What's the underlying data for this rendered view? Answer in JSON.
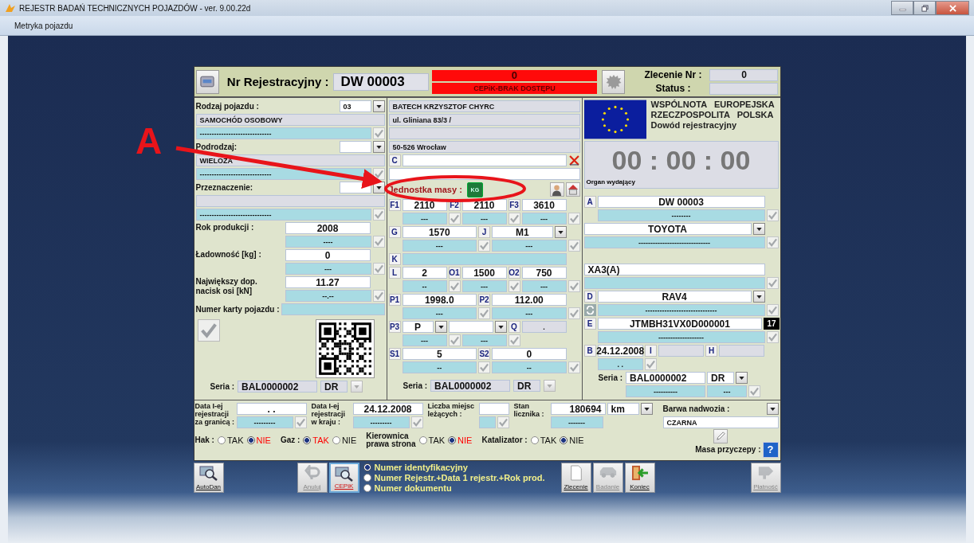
{
  "window": {
    "title": "REJESTR BADAŃ TECHNICZNYCH POJAZDÓW - ver. 9.00.22d"
  },
  "menu": [
    {
      "label": "Metryka pojazdu"
    }
  ],
  "header": {
    "plate_label": "Nr Rejestracyjny :",
    "plate": "DW 00003",
    "cepik_count": "0",
    "cepik_status": "CEPiK-BRAK DOSTĘPU",
    "order_label": "Zlecenie Nr :",
    "order": "0",
    "status_label": "Status :"
  },
  "vehicle": {
    "categories": [
      {
        "label": "Rodzaj pojazdu :",
        "code": "03",
        "name": "SAMOCHÓD OSOBOWY",
        "cepik": "------------------------------"
      },
      {
        "label": "Podrodzaj:",
        "name": "WIELOZA",
        "cepik": "------------------------------"
      },
      {
        "label": "Przeznaczenie:",
        "cepik": "------------------------------"
      }
    ],
    "numbers": [
      {
        "label": "Rok produkcji :",
        "value": "2008",
        "cepik": "----"
      },
      {
        "label": "Ładowność  [kg] :",
        "value": "0",
        "cepik": "---"
      },
      {
        "label": "Największy dop.\nnacisk osi   [kN]",
        "value": "11.27",
        "cepik": "--.--"
      }
    ],
    "card_label": "Numer karty pojazdu :",
    "series_label": "Seria :",
    "series": "BAL0000002",
    "series_type": "DR"
  },
  "owner": {
    "name": "BATECH KRZYSZTOF CHYRC",
    "street": "ul. Gliniana 83/3 /",
    "city": "50-526 Wrocław",
    "c_code": "C",
    "mass_unit_label": "Jednostka masy :",
    "mass_unit": "KG",
    "rows": [
      [
        {
          "code": "F1",
          "kind": "field",
          "value": "2110",
          "cepik": "---"
        },
        {
          "code": "F2",
          "kind": "field",
          "value": "2110",
          "cepik": "---"
        },
        {
          "code": "F3",
          "kind": "field",
          "value": "3610",
          "cepik": "---"
        }
      ],
      [
        {
          "code": "G",
          "kind": "field",
          "value": "1570",
          "cepik": "---"
        },
        {
          "code": "J",
          "kind": "combo",
          "value": "M1",
          "cepik": "---"
        }
      ],
      [
        {
          "code": "K",
          "kind": "blue"
        }
      ],
      [
        {
          "code": "L",
          "kind": "field",
          "value": "2",
          "cepik": "--"
        },
        {
          "code": "O1",
          "kind": "field",
          "value": "1500",
          "cepik": "---"
        },
        {
          "code": "O2",
          "kind": "field",
          "value": "750",
          "cepik": "---"
        }
      ],
      [
        {
          "code": "P1",
          "kind": "field",
          "value": "1998.0",
          "cepik": "---"
        },
        {
          "code": "P2",
          "kind": "field",
          "value": "112.00",
          "cepik": "---"
        }
      ],
      [
        {
          "code": "P3",
          "kind": "combo",
          "value": "P",
          "cepik": "---"
        },
        {
          "kind": "combo",
          "cepik": "---"
        },
        {
          "code": "Q",
          "kind": "grey",
          "value": "."
        }
      ],
      [
        {
          "code": "S1",
          "kind": "field",
          "value": "5",
          "cepik": "--"
        },
        {
          "code": "S2",
          "kind": "field",
          "value": "0",
          "cepik": "--"
        }
      ]
    ],
    "series_label": "Seria :",
    "series": "BAL0000002",
    "series_type": "DR"
  },
  "document": {
    "lines": [
      "WSPÓLNOTA   EUROPEJSKA",
      "RZECZPOSPOLITA   POLSKA",
      "Dowód rejestracyjny"
    ],
    "clock": "00 : 00 : 00",
    "issuer_label": "Organ wydający",
    "rows": [
      [
        {
          "code": "A",
          "kind": "field",
          "value": "DW 00003",
          "cepik": "--------"
        }
      ],
      [
        {
          "kind": "combo",
          "value": "TOYOTA",
          "cepik": "------------------------------"
        }
      ],
      [
        {
          "kind": "field",
          "value": "XA3(A)"
        }
      ],
      [
        {
          "code": "D",
          "kind": "combo",
          "value": "RAV4",
          "cepik": "------------------------------",
          "refresh_button": true
        }
      ],
      [
        {
          "code": "E",
          "kind": "field",
          "value": "JTMBH31VX0D000001",
          "badge": "17",
          "cepik": "-------------------"
        }
      ],
      [
        {
          "code": "B",
          "kind": "field",
          "value": "24.12.2008",
          "cepik": ". ."
        },
        {
          "code": "I",
          "kind": "grey"
        },
        {
          "code": "H",
          "kind": "grey"
        }
      ]
    ],
    "series_label": "Seria :",
    "series": "BAL0000002",
    "series_type": "DR",
    "series_cepik": "----------",
    "type_cepik": "---"
  },
  "details": {
    "fields": [
      {
        "label": "Data I-ej\nrejestracji\nza granicą :",
        "value": ". .",
        "cepik": "---------"
      },
      {
        "label": "Data I-ej\nrejestracji\nw kraju :",
        "value": "24.12.2008",
        "cepik": "---------"
      },
      {
        "label": "Liczba miejsc\nleżących :"
      },
      {
        "label": "Stan\nlicznika :",
        "value": "180694",
        "unit": "km",
        "cepik": "-------"
      }
    ],
    "switches": [
      {
        "label": "Hak :",
        "options": [
          {
            "label": "TAK",
            "selected": false,
            "alert": false
          },
          {
            "label": "NIE",
            "selected": true,
            "alert": true
          }
        ]
      },
      {
        "label": "Gaz :",
        "options": [
          {
            "label": "TAK",
            "selected": true,
            "alert": true
          },
          {
            "label": "NIE",
            "selected": false,
            "alert": false
          }
        ]
      },
      {
        "label": "Kierownica\nprawa strona",
        "options": [
          {
            "label": "TAK",
            "selected": false,
            "alert": false
          },
          {
            "label": "NIE",
            "selected": true,
            "alert": true
          }
        ]
      },
      {
        "label": "Katalizator :",
        "options": [
          {
            "label": "TAK",
            "selected": false,
            "alert": false
          },
          {
            "label": "NIE",
            "selected": true,
            "alert": false
          }
        ]
      }
    ],
    "color_label": "Barwa nadwozia :",
    "body_color": "CZARNA",
    "trailer_label": "Masa przyczepy :",
    "help": "?"
  },
  "toolbar": {
    "left": [
      {
        "label": "AutoDan",
        "kind": "search",
        "disabled": false,
        "selected": false
      }
    ],
    "center": [
      {
        "label": "Anuluj",
        "kind": "undo",
        "disabled": true,
        "selected": false
      },
      {
        "label": "CEPiK",
        "kind": "search",
        "disabled": false,
        "selected": true
      }
    ],
    "search_options": [
      {
        "label": "Numer identyfikacyjny",
        "selected": true
      },
      {
        "label": "Numer Rejestr.+Data 1 rejestr.+Rok prod.",
        "selected": false
      },
      {
        "label": "Numer dokumentu",
        "selected": false
      }
    ],
    "actions": [
      {
        "label": "Zlecenie",
        "kind": "document",
        "disabled": false,
        "selected": false
      },
      {
        "label": "Badanie",
        "kind": "car",
        "disabled": true,
        "selected": false
      },
      {
        "label": "Koniec",
        "kind": "exit",
        "disabled": false,
        "selected": false
      }
    ],
    "right": [
      {
        "label": "Płatność",
        "kind": "sign",
        "disabled": true,
        "selected": false
      }
    ]
  },
  "annotation": {
    "label": "A"
  }
}
